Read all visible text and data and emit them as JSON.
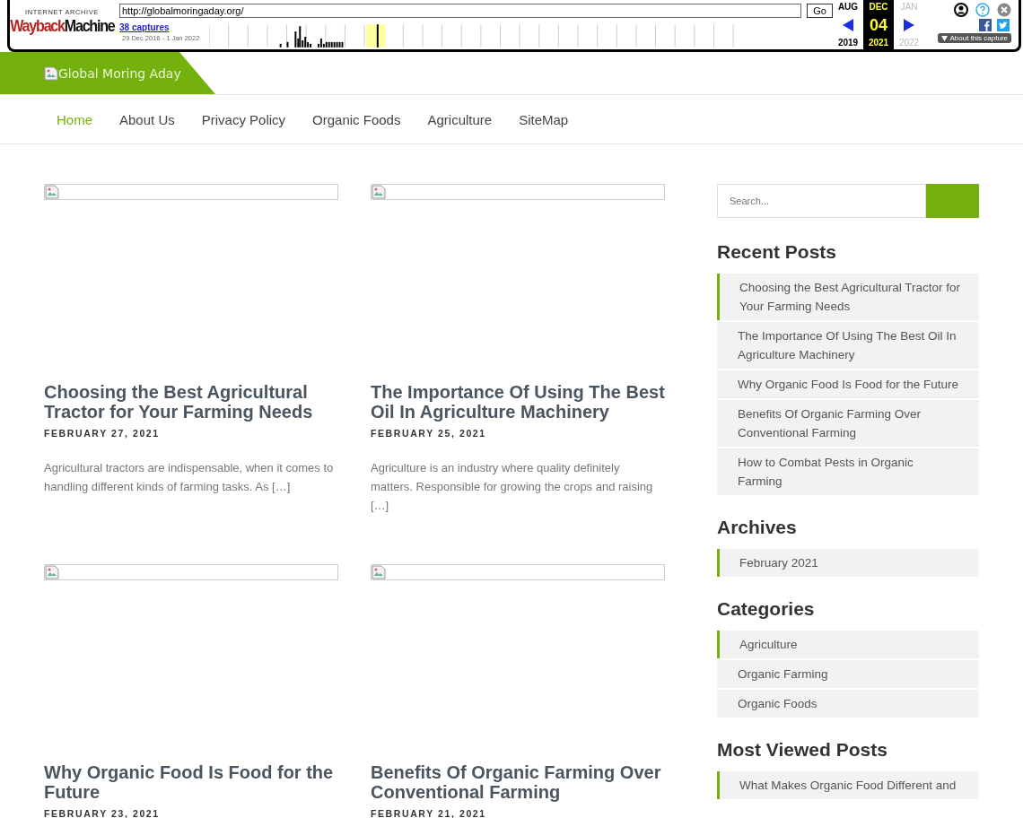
{
  "wayback_toolbar": {
    "logo_caption": "INTERNET ARCHIVE",
    "logo_words": [
      "Wayback",
      "Machine"
    ],
    "url": "http://globalmoringaday.org/",
    "go_button": "Go",
    "captures_link": "38 captures",
    "capture_range": "29 Dec 2016 - 1 Jan 2022",
    "months": [
      {
        "month": "AUG",
        "year": "2019",
        "selected": false,
        "disabled": false
      },
      {
        "month": "DEC",
        "day": "04",
        "year": "2021",
        "selected": true,
        "disabled": false
      },
      {
        "month": "JAN",
        "year": "2022",
        "selected": false,
        "disabled": true
      }
    ],
    "about_button": "About this capture"
  },
  "header": {
    "logo_alt": "Global Moring Aday"
  },
  "nav": [
    {
      "label": "Home",
      "selected": true
    },
    {
      "label": "About Us",
      "selected": false
    },
    {
      "label": "Privacy Policy",
      "selected": false
    },
    {
      "label": "Organic Foods",
      "selected": false
    },
    {
      "label": "Agriculture",
      "selected": false
    },
    {
      "label": "SiteMap",
      "selected": false
    }
  ],
  "posts": [
    {
      "title": "Choosing the Best Agricultural Tractor for Your Farming Needs",
      "date": "FEBRUARY 27, 2021",
      "excerpt": "Agricultural tractors are indispensable, when it comes to handling different kinds of farming tasks. As […]"
    },
    {
      "title": "The Importance Of Using The Best Oil In Agriculture Machinery",
      "date": "FEBRUARY 25, 2021",
      "excerpt": "Agriculture is an industry where quality definitely matters. Responsible for growing the crops and raising […]"
    },
    {
      "title": "Why Organic Food Is Food for the Future",
      "date": "FEBRUARY 23, 2021"
    },
    {
      "title": "Benefits Of Organic Farming Over Conventional Farming",
      "date": "FEBRUARY 21, 2021"
    }
  ],
  "sidebar": {
    "search": {
      "placeholder": "Search..."
    },
    "widgets": [
      {
        "title": "Recent Posts",
        "items": [
          {
            "label": "Choosing the Best Agricultural Tractor for Your Farming Needs",
            "selected": true
          },
          {
            "label": "The Importance Of Using The Best Oil In Agriculture Machinery",
            "selected": false
          },
          {
            "label": "Why Organic Food Is Food for the Future",
            "selected": false
          },
          {
            "label": "Benefits Of Organic Farming Over Conventional Farming",
            "selected": false
          },
          {
            "label": "How to Combat Pests in Organic Farming",
            "selected": false
          }
        ]
      },
      {
        "title": "Archives",
        "items": [
          {
            "label": "February 2021",
            "selected": true
          }
        ]
      },
      {
        "title": "Categories",
        "items": [
          {
            "label": "Agriculture",
            "selected": true
          },
          {
            "label": "Organic Farming",
            "selected": false
          },
          {
            "label": "Organic Foods",
            "selected": false
          }
        ]
      },
      {
        "title": "Most Viewed Posts",
        "items": [
          {
            "label": "What Makes Organic Food Different and",
            "selected": true
          }
        ]
      }
    ]
  }
}
